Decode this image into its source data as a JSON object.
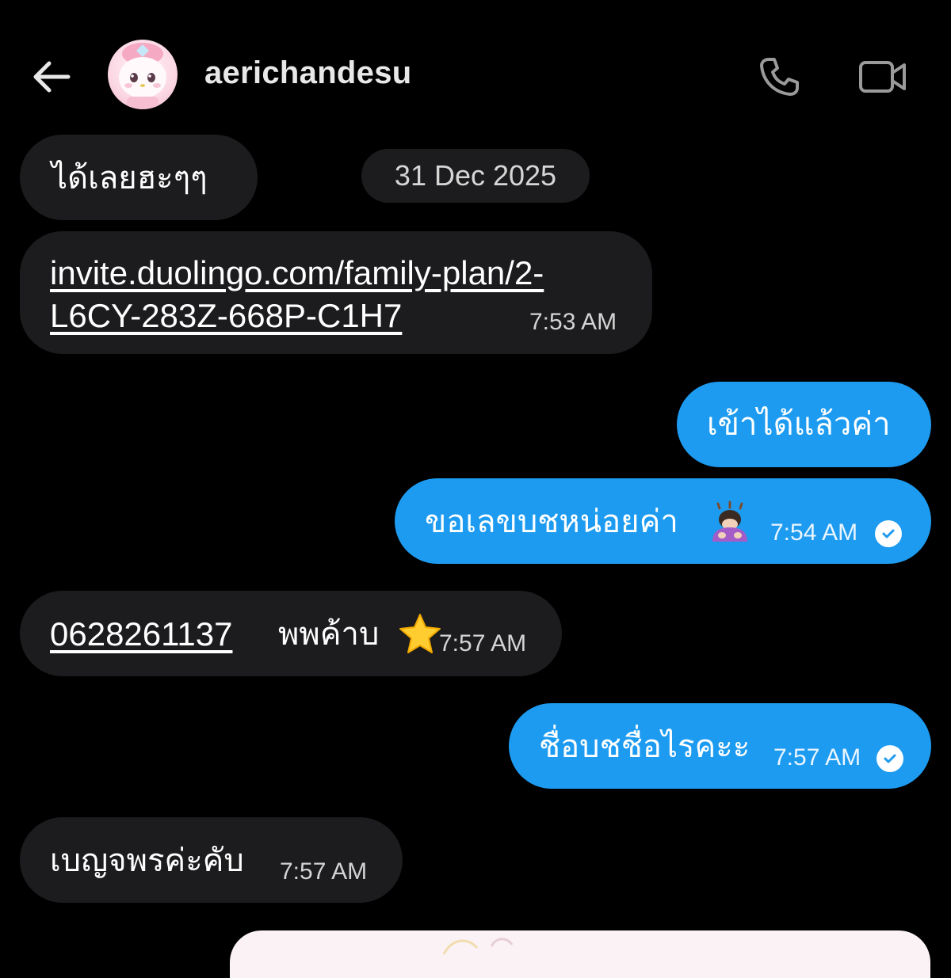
{
  "header": {
    "username": "aerichandesu",
    "back_icon": "arrow-left-icon",
    "call_icon": "phone-icon",
    "video_icon": "video-camera-icon"
  },
  "date_separator": "31 Dec 2025",
  "messages": [
    {
      "direction": "incoming",
      "text": "ได้เลยฮะๆๆ",
      "time": ""
    },
    {
      "direction": "incoming",
      "link_line1": "invite.duolingo.com/family-plan/2-",
      "link_line2": "L6CY-283Z-668P-C1H7",
      "time": "7:53 AM"
    },
    {
      "direction": "outgoing",
      "text": "เข้าได้แล้วค่า",
      "time": ""
    },
    {
      "direction": "outgoing",
      "text": "ขอเลขบชหน่อยค่า",
      "emoji": "person-bowing-emoji",
      "time": "7:54 AM",
      "read": true
    },
    {
      "direction": "incoming",
      "link": "0628261137",
      "text": "พพค้าบ",
      "emoji": "star-emoji",
      "time": "7:57 AM"
    },
    {
      "direction": "outgoing",
      "text": "ชื่อบชชื่อไรคะะ",
      "time": "7:57 AM",
      "read": true
    },
    {
      "direction": "incoming",
      "text": "เบญจพรค่ะคับ",
      "time": "7:57 AM"
    }
  ],
  "colors": {
    "background": "#000000",
    "incoming_bubble": "#1c1c1e",
    "outgoing_bubble": "#1d9bf0",
    "header_text": "#e8e8e8"
  }
}
